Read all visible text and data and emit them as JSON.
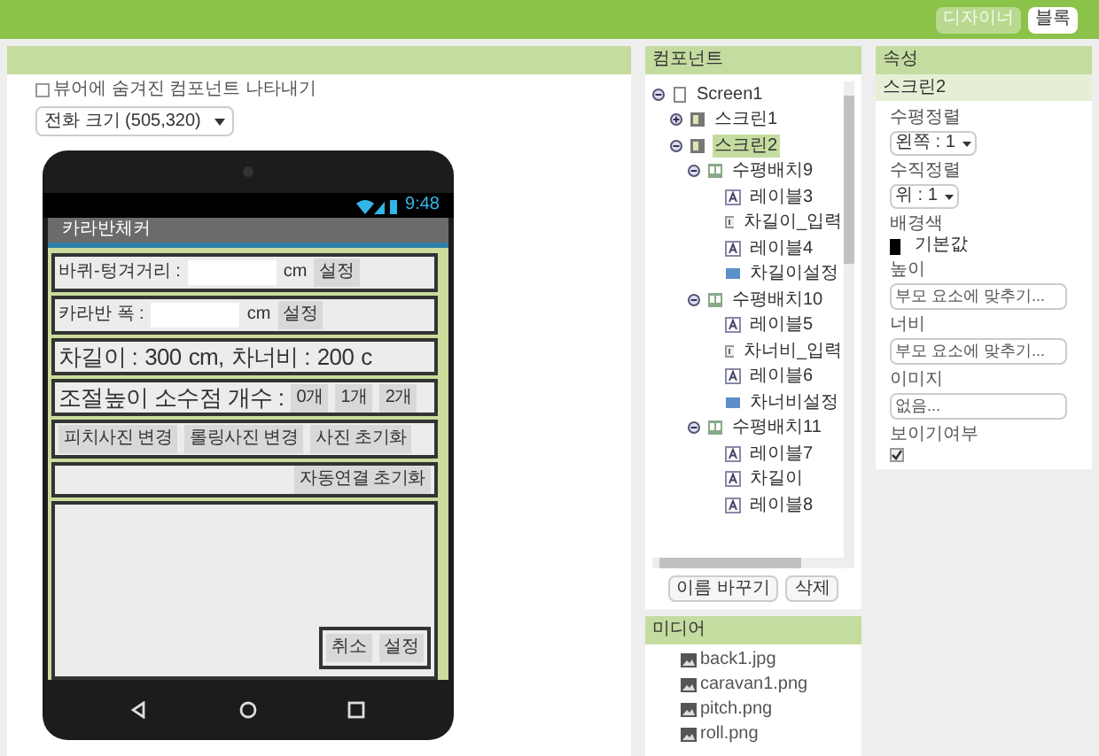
{
  "top_bar": {
    "buttons": [
      {
        "label": "디자이너",
        "selected": true
      },
      {
        "label": "블록",
        "selected": false
      }
    ]
  },
  "viewer": {
    "show_hidden": {
      "label": "뷰어에 숨겨진 컴포넌트 나타내기",
      "checked": false
    },
    "size_select": "전화 크기 (505,320)",
    "phone": {
      "time": "9:48",
      "app_title": "카라반체커",
      "rows": [
        {
          "kind": "row",
          "items": [
            {
              "kind": "label",
              "text": "바퀴-텅겨거리 :"
            },
            {
              "kind": "input"
            },
            {
              "kind": "label",
              "text": "cm"
            },
            {
              "kind": "button",
              "text": "설정"
            }
          ]
        },
        {
          "kind": "row",
          "items": [
            {
              "kind": "label",
              "text": "카라반 폭 :"
            },
            {
              "kind": "input"
            },
            {
              "kind": "label",
              "text": "cm"
            },
            {
              "kind": "button",
              "text": "설정"
            }
          ]
        },
        {
          "kind": "big-row",
          "items": [
            {
              "kind": "label",
              "text": "차길이 :"
            },
            {
              "kind": "label",
              "text": "300"
            },
            {
              "kind": "label",
              "text": "cm,"
            },
            {
              "kind": "label",
              "text": "차너비 :"
            },
            {
              "kind": "label",
              "text": "200"
            },
            {
              "kind": "label",
              "text": "c"
            }
          ]
        },
        {
          "kind": "big-row",
          "items": [
            {
              "kind": "label",
              "text": "조절높이 소수점 개수 :"
            },
            {
              "kind": "button",
              "text": "0개"
            },
            {
              "kind": "button",
              "text": "1개"
            },
            {
              "kind": "button",
              "text": "2개"
            }
          ]
        },
        {
          "kind": "row",
          "items": [
            {
              "kind": "button",
              "text": "피치사진 변경"
            },
            {
              "kind": "button",
              "text": "롤링사진 변경"
            },
            {
              "kind": "button",
              "text": "사진 초기화"
            }
          ]
        },
        {
          "kind": "end-row",
          "items": [
            {
              "kind": "button",
              "text": "자동연결 초기화"
            }
          ]
        },
        {
          "kind": "panel",
          "items": [
            {
              "kind": "button",
              "text": "취소"
            },
            {
              "kind": "button",
              "text": "설정"
            }
          ]
        }
      ]
    }
  },
  "components": {
    "title": "컴포넌트",
    "tree": [
      {
        "name": "Screen1",
        "kind": "screen",
        "selected": false,
        "expanded": true,
        "children": [
          {
            "name": "스크린1",
            "kind": "arrangement",
            "selected": false,
            "expanded": false
          },
          {
            "name": "스크린2",
            "kind": "arrangement",
            "selected": true,
            "expanded": true,
            "children": [
              {
                "name": "수평배치9",
                "kind": "horizontal",
                "selected": false,
                "expanded": true,
                "children": [
                  {
                    "name": "레이블3",
                    "kind": "label",
                    "selected": false
                  },
                  {
                    "name": "차길이_입력",
                    "kind": "textbox",
                    "selected": false
                  },
                  {
                    "name": "레이블4",
                    "kind": "label",
                    "selected": false
                  },
                  {
                    "name": "차길이설정",
                    "kind": "button",
                    "selected": false
                  }
                ]
              },
              {
                "name": "수평배치10",
                "kind": "horizontal",
                "selected": false,
                "expanded": true,
                "children": [
                  {
                    "name": "레이블5",
                    "kind": "label",
                    "selected": false
                  },
                  {
                    "name": "차너비_입력",
                    "kind": "textbox",
                    "selected": false
                  },
                  {
                    "name": "레이블6",
                    "kind": "label",
                    "selected": false
                  },
                  {
                    "name": "차너비설정",
                    "kind": "button",
                    "selected": false
                  }
                ]
              },
              {
                "name": "수평배치11",
                "kind": "horizontal",
                "selected": false,
                "expanded": true,
                "children": [
                  {
                    "name": "레이블7",
                    "kind": "label",
                    "selected": false
                  },
                  {
                    "name": "차길이",
                    "kind": "label",
                    "selected": false
                  },
                  {
                    "name": "레이블8",
                    "kind": "label",
                    "selected": false
                  }
                ]
              }
            ]
          }
        ]
      }
    ],
    "buttons": [
      "이름 바꾸기",
      "삭제"
    ]
  },
  "media": {
    "title": "미디어",
    "files": [
      "back1.jpg",
      "caravan1.png",
      "pitch.png",
      "roll.png"
    ]
  },
  "properties": {
    "title": "속성",
    "component": "스크린2",
    "fields": [
      {
        "kind": "select",
        "label": "수평정렬",
        "value": "왼쪽 : 1"
      },
      {
        "kind": "select",
        "label": "수직정렬",
        "value": "위 : 1"
      },
      {
        "kind": "color",
        "label": "배경색",
        "value": "기본값",
        "color": "#000000"
      },
      {
        "kind": "text",
        "label": "높이",
        "value": "부모 요소에 맞추기..."
      },
      {
        "kind": "text",
        "label": "너비",
        "value": "부모 요소에 맞추기..."
      },
      {
        "kind": "text",
        "label": "이미지",
        "value": "없음..."
      },
      {
        "kind": "checkbox",
        "label": "보이기여부",
        "checked": true
      }
    ]
  }
}
